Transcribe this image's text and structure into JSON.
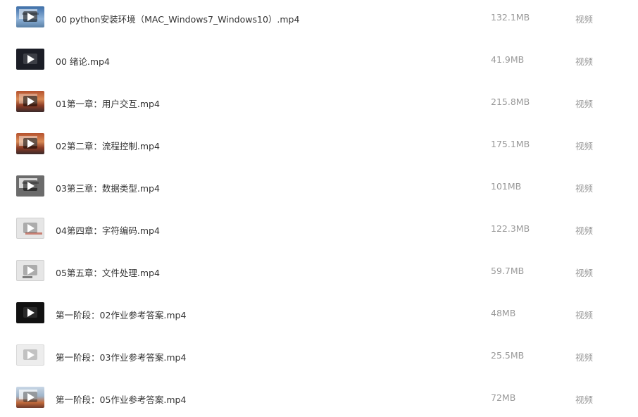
{
  "files": [
    {
      "name": "00 python安装环境（MAC_Windows7_Windows10）.mp4",
      "size": "132.1MB",
      "type": "视频",
      "thumb": "blue"
    },
    {
      "name": "00 绪论.mp4",
      "size": "41.9MB",
      "type": "视频",
      "thumb": "dark"
    },
    {
      "name": "01第一章：用户交互.mp4",
      "size": "215.8MB",
      "type": "视频",
      "thumb": "sierra"
    },
    {
      "name": "02第二章：流程控制.mp4",
      "size": "175.1MB",
      "type": "视频",
      "thumb": "sierra"
    },
    {
      "name": "03第三章：数据类型.mp4",
      "size": "101MB",
      "type": "视频",
      "thumb": "gray"
    },
    {
      "name": "04第四章：字符编码.mp4",
      "size": "122.3MB",
      "type": "视频",
      "thumb": "light"
    },
    {
      "name": "05第五章：文件处理.mp4",
      "size": "59.7MB",
      "type": "视频",
      "thumb": "light"
    },
    {
      "name": "第一阶段：02作业参考答案.mp4",
      "size": "48MB",
      "type": "视频",
      "thumb": "black"
    },
    {
      "name": "第一阶段：03作业参考答案.mp4",
      "size": "25.5MB",
      "type": "视频",
      "thumb": "pale"
    },
    {
      "name": "第一阶段：05作业参考答案.mp4",
      "size": "72MB",
      "type": "视频",
      "thumb": "desk"
    }
  ]
}
